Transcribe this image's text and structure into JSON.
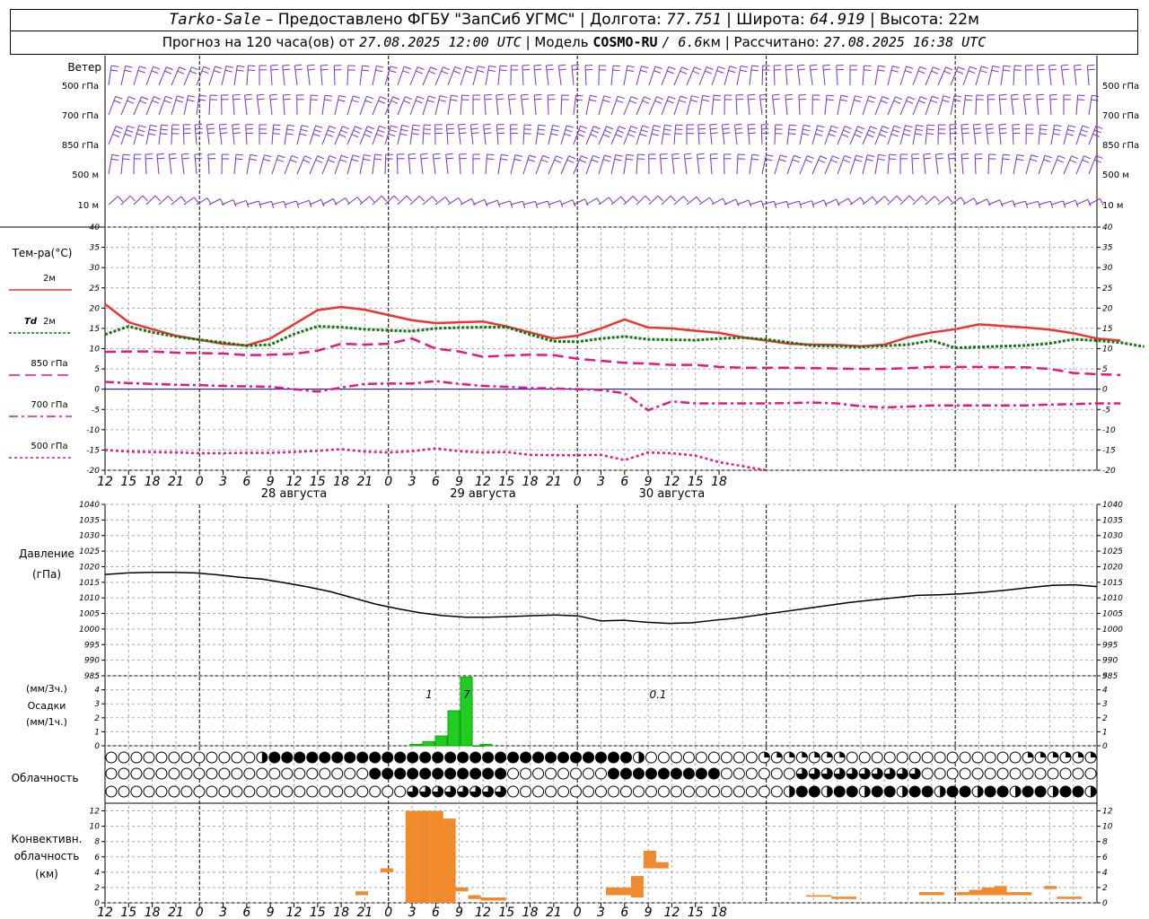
{
  "header": {
    "station": "Tarko-Sale",
    "provider": "Предоставлено ФГБУ \"ЗапСиб УГМС\"",
    "lon_label": "Долгота:",
    "lon_value": "77.751",
    "lat_label": "Широта:",
    "lat_value": "64.919",
    "alt_label": "Высота:",
    "alt_value": "22м",
    "forecast_prefix": "Прогноз на 120 часа(ов) от",
    "forecast_time": "27.08.2025 12:00 UTC",
    "model_label": "Модель",
    "model_name": "COSMO-RU",
    "model_res": "/ 6.6",
    "model_res_unit": "км",
    "calc_label": "Рассчитано:",
    "calc_time": "27.08.2025 16:38 UTC"
  },
  "colors": {
    "t2m": "#ee3333",
    "td2m": "#117711",
    "t850": "#e8177f",
    "t700": "#e8177f",
    "t500": "#e8177f",
    "wind": "#7a2fd0",
    "precip": "#22cc22",
    "convective": "#f08a2c",
    "zero_line": "#0000cc"
  },
  "chart_data": [
    {
      "type": "wind_barbs",
      "title": "Ветер",
      "levels": [
        "500 гПа",
        "700 гПа",
        "850 гПа",
        "500 м",
        "10 м"
      ]
    },
    {
      "type": "line",
      "title": "Тем-ра(°С)",
      "ylim": [
        -20,
        40
      ],
      "yticks": [
        -20,
        -15,
        -10,
        -5,
        0,
        5,
        10,
        15,
        20,
        25,
        30,
        35,
        40
      ],
      "x_hours": [
        0,
        3,
        6,
        9,
        12,
        15,
        18,
        21,
        24,
        27,
        30,
        33,
        36,
        39,
        42,
        45,
        48,
        51,
        54,
        57,
        60,
        63,
        66,
        69,
        72,
        75,
        78,
        81,
        84,
        87,
        90,
        93,
        96,
        99,
        102,
        105,
        108,
        111,
        114,
        117,
        120
      ],
      "series": [
        {
          "name": "2м",
          "style": "solid",
          "values": [
            21,
            16.5,
            14.8,
            13.2,
            12.2,
            11.2,
            10.8,
            12.5,
            16,
            19.5,
            20.3,
            19.6,
            18.3,
            17,
            16.3,
            16.5,
            16.7,
            15.5,
            14,
            12.5,
            13.2,
            15,
            17.2,
            15.2,
            15,
            14.4,
            13.9,
            12.8,
            12,
            11.2,
            11,
            10.9,
            10.6,
            11,
            12.8,
            14,
            14.8,
            16,
            15.6,
            15.2,
            14.7,
            13.8,
            12.5,
            12
          ]
        },
        {
          "name": "Td 2м",
          "style": "dotted",
          "values": [
            13.5,
            15.5,
            14,
            13,
            12.2,
            11.5,
            10.7,
            11,
            13.6,
            15.5,
            15.3,
            14.8,
            14.5,
            14.3,
            15,
            15.2,
            15.3,
            15.3,
            13.5,
            11.8,
            11.7,
            12.5,
            13,
            12.3,
            12.2,
            12.1,
            12.5,
            12.7,
            12.3,
            11.5,
            10.7,
            10.6,
            10.4,
            10.7,
            11,
            12,
            10.2,
            10.4,
            10.6,
            10.8,
            11.3,
            12.3,
            12,
            11.5,
            10.5
          ]
        },
        {
          "name": "850 гПа",
          "style": "dash",
          "values": [
            9.2,
            9.3,
            9.3,
            9,
            8.9,
            8.8,
            8.4,
            8.5,
            8.7,
            9.5,
            11.2,
            11,
            11.2,
            12.5,
            10,
            9.3,
            8,
            8.3,
            8.5,
            8.4,
            7.5,
            7,
            6.5,
            6.3,
            6,
            6,
            5.5,
            5.3,
            5.3,
            5.3,
            5.2,
            5.1,
            5,
            5,
            5.2,
            5.5,
            5.5,
            5.5,
            5.4,
            5.4,
            5,
            4,
            3.7,
            3.5
          ]
        },
        {
          "name": "700 гПа",
          "style": "dashdot",
          "values": [
            1.8,
            1.5,
            1.3,
            1.1,
            1,
            0.8,
            0.7,
            0.6,
            0,
            -0.6,
            0.4,
            1.3,
            1.4,
            1.4,
            2,
            1.3,
            0.8,
            0.6,
            0.3,
            0.2,
            0,
            -0.2,
            -1,
            -5.2,
            -3,
            -3.5,
            -3.5,
            -3.5,
            -3.5,
            -3.4,
            -3.3,
            -3.5,
            -4.2,
            -4.5,
            -4.3,
            -4,
            -4,
            -4,
            -4,
            -4,
            -3.8,
            -3.7,
            -3.5,
            -3.5
          ]
        },
        {
          "name": "500 гПа",
          "style": "dotted-fine",
          "values": [
            -15,
            -15.4,
            -15.5,
            -15.6,
            -15.8,
            -15.8,
            -15.7,
            -15.7,
            -15.5,
            -15.2,
            -14.8,
            -15.4,
            -15.6,
            -15.3,
            -14.6,
            -15.3,
            -15.6,
            -15.5,
            -16.2,
            -16.3,
            -16.3,
            -16.2,
            -17.5,
            -15.6,
            -15.8,
            -16.4,
            -18,
            -19,
            -20
          ]
        }
      ]
    },
    {
      "type": "line",
      "title": "Давление",
      "ylabel": "(гПа)",
      "ylim": [
        985,
        1040
      ],
      "yticks": [
        985,
        990,
        995,
        1000,
        1005,
        1010,
        1015,
        1020,
        1025,
        1030,
        1035,
        1040
      ],
      "series": [
        {
          "name": "",
          "values": [
            1017.5,
            1018,
            1018.2,
            1018.2,
            1018,
            1017.4,
            1016.6,
            1016,
            1014.8,
            1013.5,
            1012,
            1010,
            1008,
            1006.5,
            1005.2,
            1004.3,
            1003.8,
            1003.8,
            1004,
            1004.3,
            1004.5,
            1004.2,
            1002.6,
            1002.8,
            1002.2,
            1001.8,
            1002,
            1002.8,
            1003.5,
            1004.5,
            1005.5,
            1006.5,
            1007.5,
            1008.5,
            1009.3,
            1010,
            1010.8,
            1011,
            1011.3,
            1011.8,
            1012.5,
            1013.3,
            1014,
            1014.2,
            1013.6
          ]
        }
      ]
    },
    {
      "type": "bar",
      "title": "Осадки",
      "ylabel": "(мм/3ч.)",
      "ylabel2": "(мм/1ч.)",
      "ylim": [
        0,
        5
      ],
      "yticks": [
        0,
        1,
        2,
        3,
        4,
        5
      ],
      "x_hours": [
        24,
        25,
        26,
        27,
        28,
        29,
        41
      ],
      "values": [
        0.1,
        0.3,
        0.7,
        2.5,
        4.9,
        0.0,
        0.1
      ],
      "annotations": [
        {
          "x_hour": 25,
          "text": "1"
        },
        {
          "x_hour": 28,
          "text": "7"
        },
        {
          "x_hour": 41,
          "text": "0.1"
        }
      ]
    },
    {
      "type": "cloud_symbols",
      "title": "Облачность",
      "rows": 3
    },
    {
      "type": "bar",
      "title": "Конвективн.",
      "title2": "облачность",
      "ylabel": "(км)",
      "ylim": [
        0,
        13
      ],
      "yticks": [
        0,
        2,
        4,
        6,
        8,
        10,
        12
      ],
      "bars": [
        {
          "x_hour": 20,
          "bottom": 1.0,
          "top": 1.5
        },
        {
          "x_hour": 22,
          "bottom": 4.0,
          "top": 4.5
        },
        {
          "x_hour": 24,
          "bottom": 0,
          "top": 12
        },
        {
          "x_hour": 25,
          "bottom": 0,
          "top": 12
        },
        {
          "x_hour": 26,
          "bottom": 0,
          "top": 12
        },
        {
          "x_hour": 27,
          "bottom": 0,
          "top": 11
        },
        {
          "x_hour": 28,
          "bottom": 1.5,
          "top": 2
        },
        {
          "x_hour": 29,
          "bottom": 0.5,
          "top": 1
        },
        {
          "x_hour": 30,
          "bottom": 0.3,
          "top": 0.7
        },
        {
          "x_hour": 31,
          "bottom": 0.3,
          "top": 0.7
        },
        {
          "x_hour": 40,
          "bottom": 1,
          "top": 2
        },
        {
          "x_hour": 41,
          "bottom": 1,
          "top": 2
        },
        {
          "x_hour": 42,
          "bottom": 0.7,
          "top": 3.5
        },
        {
          "x_hour": 43,
          "bottom": 4.5,
          "top": 6.8
        },
        {
          "x_hour": 44,
          "bottom": 4.5,
          "top": 5.3
        },
        {
          "x_hour": 56,
          "bottom": 0.8,
          "top": 1
        },
        {
          "x_hour": 57,
          "bottom": 0.8,
          "top": 1
        },
        {
          "x_hour": 58,
          "bottom": 0.5,
          "top": 0.8
        },
        {
          "x_hour": 59,
          "bottom": 0.5,
          "top": 0.8
        },
        {
          "x_hour": 65,
          "bottom": 1,
          "top": 1.4
        },
        {
          "x_hour": 66,
          "bottom": 1,
          "top": 1.4
        },
        {
          "x_hour": 68,
          "bottom": 1,
          "top": 1.4
        },
        {
          "x_hour": 69,
          "bottom": 1,
          "top": 1.7
        },
        {
          "x_hour": 70,
          "bottom": 1,
          "top": 2
        },
        {
          "x_hour": 71,
          "bottom": 1,
          "top": 2.2
        },
        {
          "x_hour": 72,
          "bottom": 1,
          "top": 1.4
        },
        {
          "x_hour": 73,
          "bottom": 1,
          "top": 1.4
        },
        {
          "x_hour": 75,
          "bottom": 1.8,
          "top": 2.2
        },
        {
          "x_hour": 76,
          "bottom": 0.5,
          "top": 0.8
        },
        {
          "x_hour": 77,
          "bottom": 0.5,
          "top": 0.8
        }
      ]
    }
  ],
  "axis": {
    "hour_labels": [
      "12",
      "15",
      "18",
      "21",
      "0",
      "3",
      "6",
      "9",
      "12",
      "15",
      "18",
      "21",
      "0",
      "3",
      "6",
      "9",
      "12",
      "15",
      "18",
      "21",
      "0",
      "3",
      "6",
      "9",
      "12",
      "15",
      "18"
    ],
    "day_labels": [
      "28 августа",
      "29 августа",
      "30 августа"
    ]
  },
  "legend": {
    "t2m_label": "2м",
    "td_label": "Td",
    "td_suffix": "2м",
    "t850_label": "850 гПа",
    "t700_label": "700 гПа",
    "t500_label": "500 гПа"
  }
}
